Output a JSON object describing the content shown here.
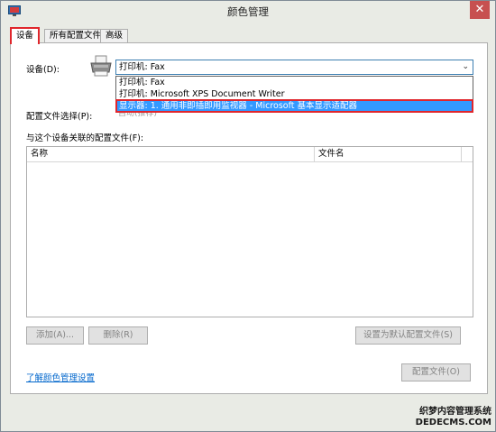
{
  "window": {
    "title": "颜色管理",
    "close_glyph": "✕"
  },
  "tabs": [
    {
      "label": "设备"
    },
    {
      "label": "所有配置文件"
    },
    {
      "label": "高级"
    }
  ],
  "device": {
    "label": "设备(D):",
    "selected_value": "打印机: Fax",
    "options": [
      "打印机: Fax",
      "打印机: Microsoft XPS Document Writer",
      "显示器: 1. 通用非即插即用监视器 - Microsoft 基本显示适配器"
    ]
  },
  "profile_selection": {
    "label": "配置文件选择(P):",
    "value": "自动(推荐)"
  },
  "associated": {
    "label": "与这个设备关联的配置文件(F):",
    "columns": [
      "名称",
      "文件名"
    ]
  },
  "buttons": {
    "add": "添加(A)...",
    "remove": "删除(R)",
    "set_default": "设置为默认配置文件(S)",
    "profiles": "配置文件(O)"
  },
  "link": {
    "learn_more": "了解颜色管理设置"
  },
  "watermark": {
    "line1": "织梦内容管理系统",
    "line2": "DEDECMS.COM"
  },
  "colors": {
    "highlight_red": "#e0262c",
    "selection_blue": "#3399ff",
    "link_blue": "#0066cc"
  }
}
